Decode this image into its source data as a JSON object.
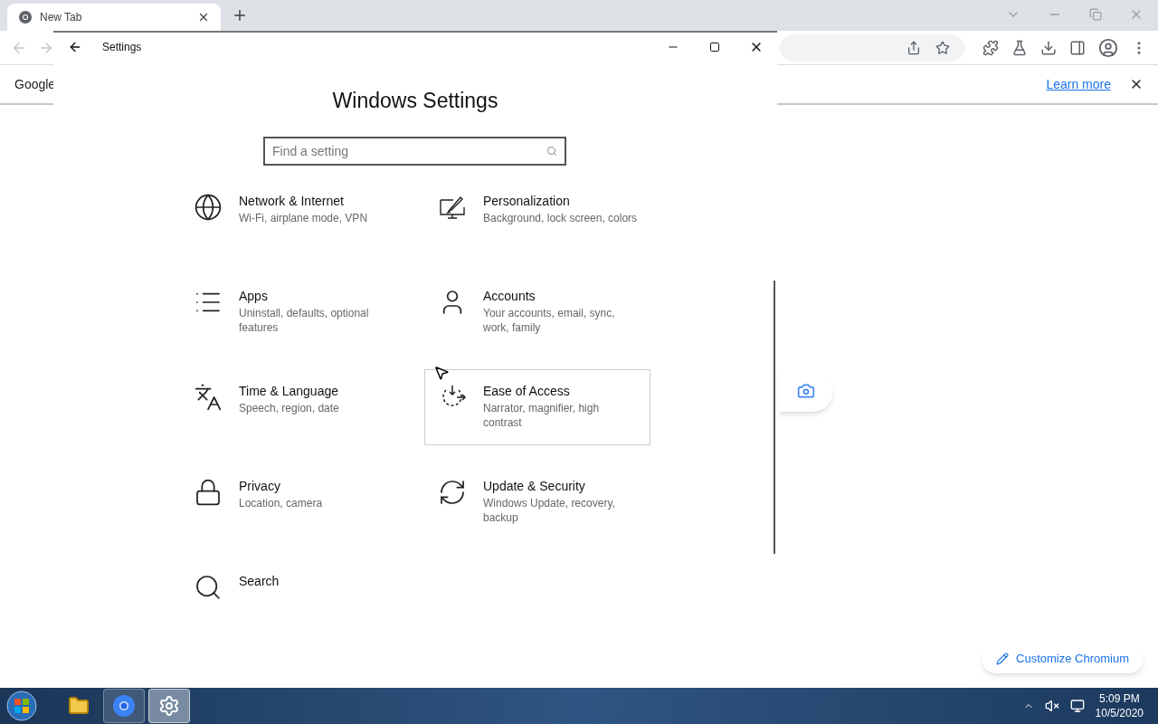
{
  "browser": {
    "tab": {
      "title": "New Tab",
      "selected": true
    },
    "infobar": {
      "text": "Google",
      "link": "Learn more"
    },
    "customize_button": "Customize Chromium"
  },
  "settings_window": {
    "title": "Settings",
    "heading": "Windows Settings",
    "search": {
      "placeholder": "Find a setting"
    },
    "categories": [
      {
        "kind": "globe",
        "title": "Network & Internet",
        "subtitle": "Wi-Fi, airplane mode, VPN",
        "hovered": false
      },
      {
        "kind": "personalization",
        "title": "Personalization",
        "subtitle": "Background, lock screen, colors",
        "hovered": false
      },
      {
        "kind": "apps",
        "title": "Apps",
        "subtitle": "Uninstall, defaults, optional features",
        "hovered": false
      },
      {
        "kind": "user",
        "title": "Accounts",
        "subtitle": "Your accounts, email, sync, work, family",
        "hovered": false
      },
      {
        "kind": "time",
        "title": "Time & Language",
        "subtitle": "Speech, region, date",
        "hovered": false
      },
      {
        "kind": "ease",
        "title": "Ease of Access",
        "subtitle": "Narrator, magnifier, high contrast",
        "hovered": true
      },
      {
        "kind": "lock",
        "title": "Privacy",
        "subtitle": "Location, camera",
        "hovered": false
      },
      {
        "kind": "update",
        "title": "Update & Security",
        "subtitle": "Windows Update, recovery, backup",
        "hovered": false
      },
      {
        "kind": "search",
        "title": "Search",
        "hovered": false
      }
    ]
  },
  "taskbar": {
    "apps": [
      {
        "kind": "folder",
        "running": false,
        "selected": false
      },
      {
        "kind": "chrome",
        "running": true,
        "selected": false
      },
      {
        "kind": "gear",
        "selected": true
      }
    ],
    "time": "5:09 PM",
    "date": "10/5/2020"
  }
}
